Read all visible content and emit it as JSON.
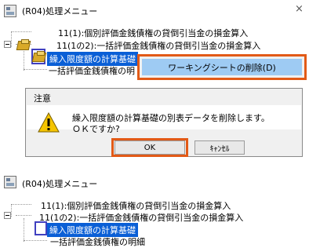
{
  "top_window": {
    "title": "(R04)処理メニュー",
    "close": "×",
    "tree": {
      "item1": "11(1):個別評価金銭債権の貸倒引当金の損金算入",
      "item2": "11(1の2):一括評価金銭債権の貸倒引当金の損金算入",
      "item3_selected": "繰入限度額の計算基礎",
      "item4": "一括評価金銭債権の明"
    }
  },
  "context_menu": {
    "delete_label": "ワーキングシートの削除(D)"
  },
  "dialog": {
    "title": "注意",
    "message_line1": "繰入限度額の計算基礎の別表データを削除します。",
    "message_line2": "ＯＫですか?",
    "ok_label": "OK",
    "cancel_label": "ｷｬﾝｾﾙ"
  },
  "bottom_window": {
    "title": "(R04)処理メニュー",
    "tree": {
      "item1": "11(1):個別評価金銭債権の貸倒引当金の損金算入",
      "item2": "11(1の2):一括評価金銭債権の貸倒引当金の損金算入",
      "item3_selected": "繰入限度額の計算基礎",
      "item4": "一括評価金銭債権の明細"
    }
  },
  "colors": {
    "selection": "#0a5fd6",
    "highlight_frame": "#4040c0",
    "annotation_orange": "#e25a17",
    "menu_hover": "#9ecbf3"
  }
}
